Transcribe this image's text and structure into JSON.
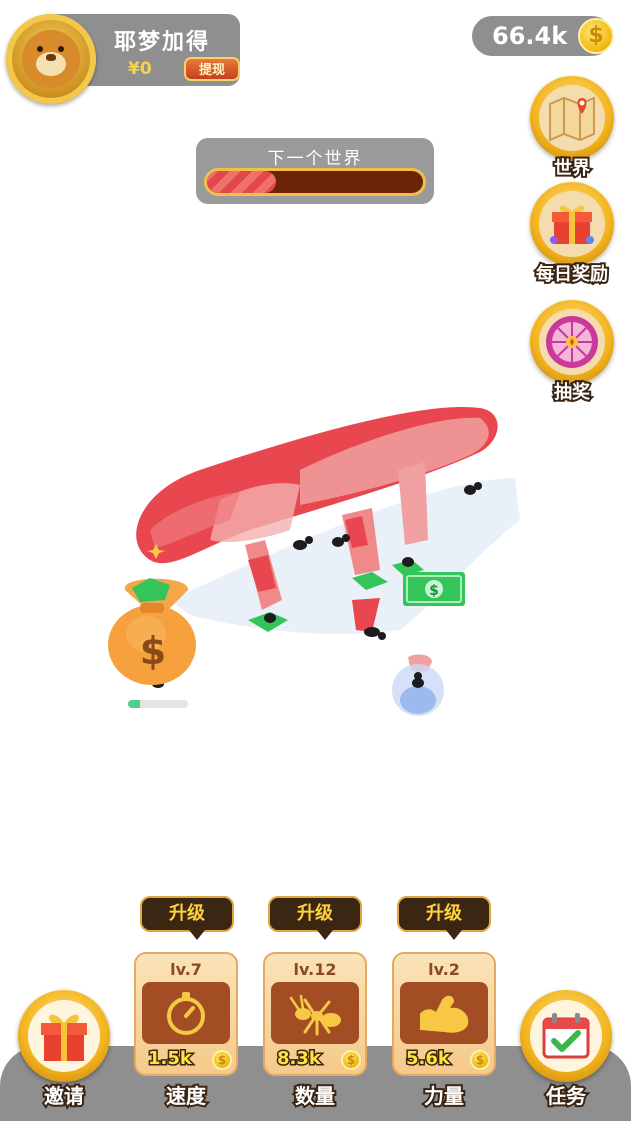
{
  "player": {
    "name": "耶梦加得",
    "balance": "¥0",
    "withdraw_label": "提现",
    "avatar_icon": "lion-icon"
  },
  "coins": {
    "amount": "66.4k",
    "icon": "coin-icon",
    "coin_symbol": "$"
  },
  "world_progress": {
    "label": "下一个世界",
    "fraction": 0.32
  },
  "side_buttons": [
    {
      "label": "世界",
      "icon": "map-icon"
    },
    {
      "label": "每日奖励",
      "icon": "gift-box-icon"
    },
    {
      "label": "抽奖",
      "icon": "prize-wheel-icon"
    }
  ],
  "upgrades": [
    {
      "tip": "升级",
      "level": "lv.7",
      "price": "1.5k",
      "label": "速度",
      "icon": "stopwatch-icon"
    },
    {
      "tip": "升级",
      "level": "lv.12",
      "price": "8.3k",
      "label": "数量",
      "icon": "ant-icon"
    },
    {
      "tip": "升级",
      "level": "lv.2",
      "price": "5.6k",
      "label": "力量",
      "icon": "muscle-arm-icon"
    }
  ],
  "bottom_buttons": {
    "invite": {
      "label": "邀请",
      "icon": "gift-icon"
    },
    "tasks": {
      "label": "任务",
      "icon": "calendar-check-icon"
    }
  },
  "scene": {
    "money_bag_symbol": "$",
    "cash_symbol": "$",
    "bag_progress": 0.2
  },
  "colors": {
    "sausage": "#e9474f",
    "cash": "#35c45a",
    "panel": "#8f8f8f",
    "gold": "#f2b21c",
    "upgrade_tip": "#3a2612"
  }
}
